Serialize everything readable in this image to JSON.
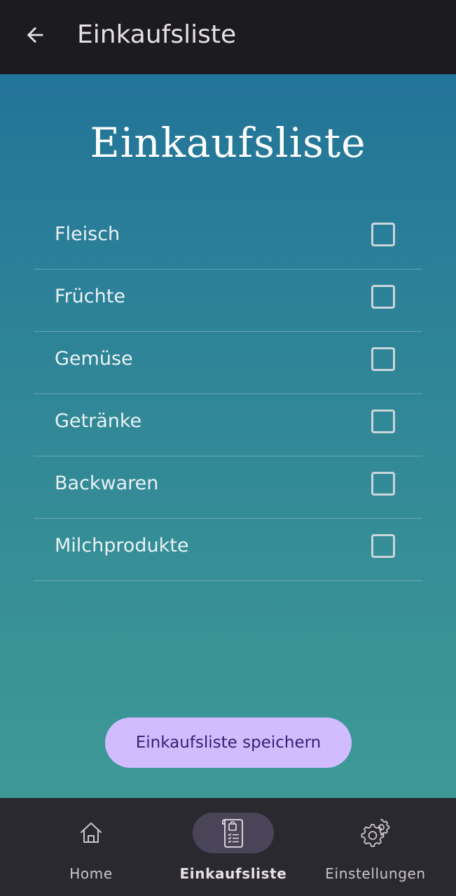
{
  "topbar": {
    "title": "Einkaufsliste",
    "back_icon": "arrow-left-icon"
  },
  "page": {
    "title": "Einkaufsliste"
  },
  "list": {
    "items": [
      {
        "label": "Fleisch",
        "checked": false
      },
      {
        "label": "Früchte",
        "checked": false
      },
      {
        "label": "Gemüse",
        "checked": false
      },
      {
        "label": "Getränke",
        "checked": false
      },
      {
        "label": "Backwaren",
        "checked": false
      },
      {
        "label": "Milchprodukte",
        "checked": false
      }
    ]
  },
  "actions": {
    "save_label": "Einkaufsliste speichern"
  },
  "navbar": {
    "items": [
      {
        "label": "Home",
        "icon": "home-icon",
        "active": false
      },
      {
        "label": "Einkaufsliste",
        "icon": "shopping-list-icon",
        "active": true
      },
      {
        "label": "Einstellungen",
        "icon": "gear-icon",
        "active": false
      }
    ]
  },
  "colors": {
    "topbar_bg": "#1c1b1f",
    "gradient_top": "#237499",
    "gradient_bottom": "#3e9996",
    "button_bg": "#d0bcff",
    "button_text": "#381e72",
    "navbar_bg": "#2b2930",
    "nav_active_pill": "#4a4458"
  }
}
